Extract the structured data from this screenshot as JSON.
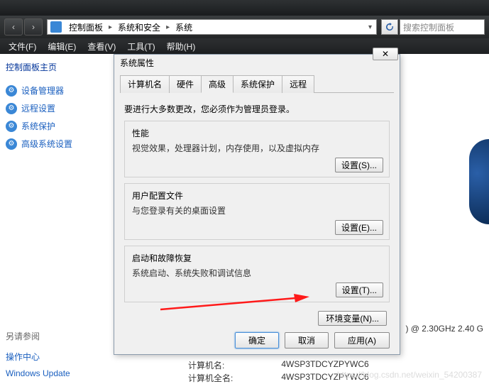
{
  "nav": {
    "back": "‹",
    "fwd": "›"
  },
  "breadcrumb": {
    "root": "控制面板",
    "seg2": "系统和安全",
    "seg3": "系统"
  },
  "search": {
    "placeholder": "搜索控制面板"
  },
  "menu": {
    "file": "文件(F)",
    "edit": "编辑(E)",
    "view": "查看(V)",
    "tools": "工具(T)",
    "help": "帮助(H)"
  },
  "sidebar": {
    "home": "控制面板主页",
    "links": [
      {
        "icon": "⚙",
        "label": "设备管理器"
      },
      {
        "icon": "⚙",
        "label": "远程设置"
      },
      {
        "icon": "⚙",
        "label": "系统保护"
      },
      {
        "icon": "⚙",
        "label": "高级系统设置"
      }
    ],
    "see_also": "另请参阅",
    "action_center": "操作中心",
    "win_update": "Windows Update"
  },
  "content": {
    "computer_name_label": "计算机名:",
    "computer_name": "4WSP3TDCYZPYWC6",
    "full_name_label": "计算机全名:",
    "full_name": "4WSP3TDCYZPYWC6",
    "cpu": ") @ 2.30GHz   2.40 G"
  },
  "dialog": {
    "title": "系统属性",
    "tabs": {
      "computer": "计算机名",
      "hardware": "硬件",
      "advanced": "高级",
      "protection": "系统保护",
      "remote": "远程"
    },
    "note": "要进行大多数更改，您必须作为管理员登录。",
    "perf": {
      "title": "性能",
      "desc": "视觉效果，处理器计划，内存使用，以及虚拟内存",
      "btn": "设置(S)..."
    },
    "profile": {
      "title": "用户配置文件",
      "desc": "与您登录有关的桌面设置",
      "btn": "设置(E)..."
    },
    "startup": {
      "title": "启动和故障恢复",
      "desc": "系统启动、系统失败和调试信息",
      "btn": "设置(T)..."
    },
    "env_btn": "环境变量(N)...",
    "ok": "确定",
    "cancel": "取消",
    "apply": "应用(A)"
  },
  "watermark": "https://blog.csdn.net/weixin_54200387"
}
